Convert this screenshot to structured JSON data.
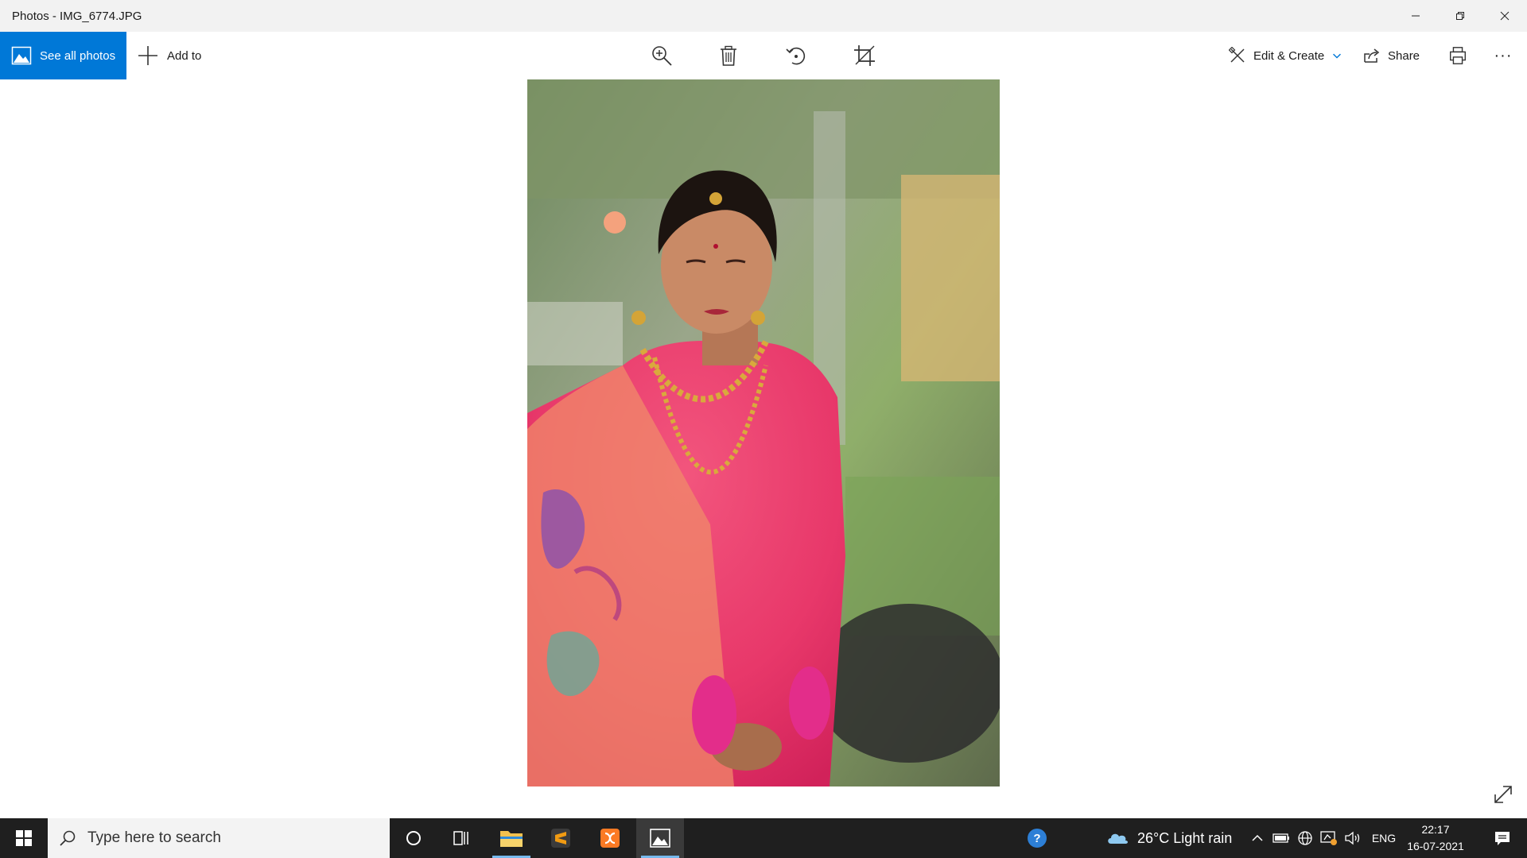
{
  "window": {
    "title": "Photos - IMG_6774.JPG"
  },
  "toolbar": {
    "see_all_label": "See all photos",
    "add_to_label": "Add to",
    "edit_create_label": "Edit & Create",
    "share_label": "Share",
    "more_label": "···"
  },
  "taskbar": {
    "search_placeholder": "Type here to search",
    "weather_text": "26°C  Light rain",
    "language": "ENG",
    "time": "22:17",
    "date": "16-07-2021"
  },
  "colors": {
    "accent": "#0078d7",
    "taskbar_bg": "#1f1f1f",
    "titlebar_bg": "#f2f2f2"
  }
}
